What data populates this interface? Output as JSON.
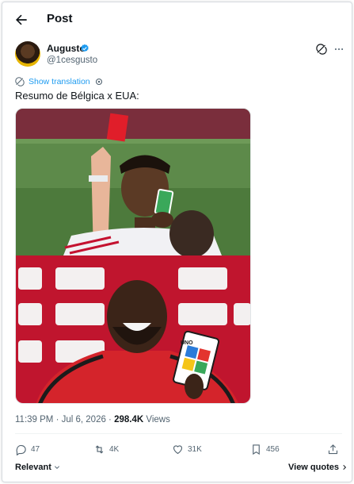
{
  "header": {
    "title": "Post",
    "back_icon": "arrow-left-icon"
  },
  "author": {
    "name": "Augusto",
    "handle": "@1cesgusto",
    "verified_color": "#1d9bf0"
  },
  "translation": {
    "label": "Show translation"
  },
  "tweet": {
    "text": "Resumo de Bélgica x EUA:"
  },
  "meta": {
    "time": "11:39 PM · Jul 6, 2026 · ",
    "views_count": "298.4K",
    "views_label": " Views"
  },
  "actions": {
    "replies": "47",
    "reposts": "4K",
    "likes": "31K",
    "bookmarks": "456"
  },
  "footer": {
    "sort_label": "Relevant",
    "view_quotes": "View quotes"
  },
  "media": {
    "top_panel": {
      "card_label": "red card"
    },
    "bottom_panel": {
      "card_label": "UNO"
    }
  },
  "colors": {
    "accent": "#1d9bf0",
    "text": "#0f1419",
    "muted": "#536471"
  }
}
